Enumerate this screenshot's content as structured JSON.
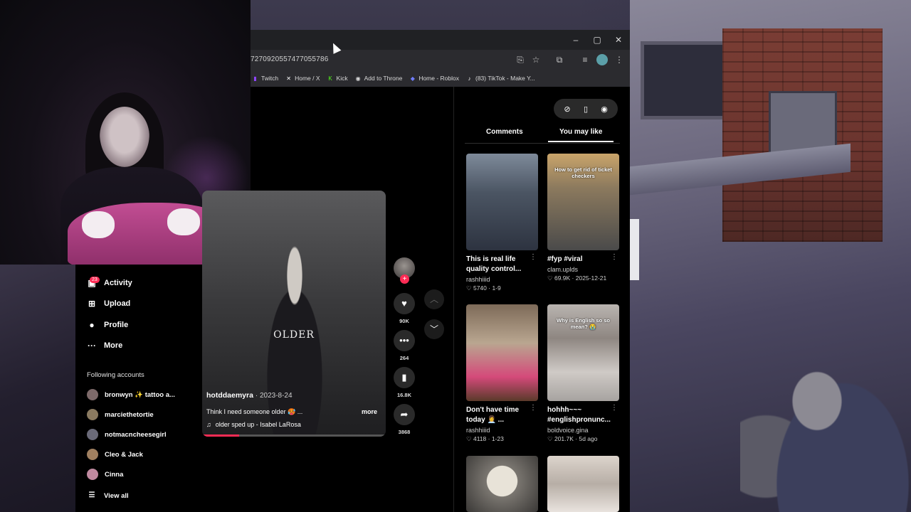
{
  "browser": {
    "url": "7270920557477055786",
    "bookmarks": [
      {
        "label": "Twitch",
        "icon": "twitch-icon",
        "color": "#9146ff",
        "glyph": "▮"
      },
      {
        "label": "Home / X",
        "icon": "x-icon",
        "color": "#ffffff",
        "glyph": "✕"
      },
      {
        "label": "Kick",
        "icon": "kick-icon",
        "color": "#53fc18",
        "glyph": "K"
      },
      {
        "label": "Add to Throne",
        "icon": "throne-icon",
        "color": "#dddddd",
        "glyph": "◉"
      },
      {
        "label": "Home - Roblox",
        "icon": "roblox-icon",
        "color": "#6f7dff",
        "glyph": "◆"
      },
      {
        "label": "(83) TikTok - Make Y...",
        "icon": "tiktok-icon",
        "color": "#ffffff",
        "glyph": "♪"
      }
    ]
  },
  "sidebar": {
    "items": [
      {
        "label": "Activity",
        "icon": "inbox-icon",
        "badge": "23"
      },
      {
        "label": "Upload",
        "icon": "upload-icon"
      },
      {
        "label": "Profile",
        "icon": "profile-icon"
      },
      {
        "label": "More",
        "icon": "more-icon"
      }
    ],
    "following_header": "Following accounts",
    "accounts": [
      {
        "name": "bronwyn ✨ tattoo a...",
        "color": "#7d6a6a"
      },
      {
        "name": "marciethetortie",
        "color": "#8a7a60"
      },
      {
        "name": "notmacncheesegirl",
        "color": "#6a6a78"
      },
      {
        "name": "Cleo & Jack",
        "color": "#a08060"
      },
      {
        "name": "Cinna",
        "color": "#c08aa0"
      }
    ],
    "view_all": "View all"
  },
  "video": {
    "overlay_text": "OLDER",
    "username": "hotddaemyra",
    "date": "· 2023-8-24",
    "caption": "Think I need someone older 🥵 ...",
    "more": "more",
    "music": "older sped up - Isabel LaRosa",
    "progress": 0.2
  },
  "actions": {
    "likes": "90K",
    "comments": "264",
    "saves": "16.8K",
    "shares": "3868"
  },
  "right_panel": {
    "tabs": [
      "Comments",
      "You may like"
    ],
    "active_tab": "You may like",
    "cards": [
      {
        "title": "This is real life quality control...",
        "author": "rashhiiid",
        "stats": "♡ 5740 · 1-9",
        "thumb_text": "",
        "thumb": "th1"
      },
      {
        "title": "#fyp #viral",
        "author": "clam.uplds",
        "stats": "♡ 69.9K · 2025-12-21",
        "thumb_text": "How to get rid of ticket checkers",
        "thumb": "th2"
      },
      {
        "title": "Don't have time today 👩‍💼 ...",
        "author": "rashhiiid",
        "stats": "♡ 4118 · 1-23",
        "thumb_text": "",
        "thumb": "th3"
      },
      {
        "title": "hohhh~~~ #englishpronunc...",
        "author": "boldvoice.gina",
        "stats": "♡ 201.7K · 5d ago",
        "thumb_text": "Why is English so so mean? 😭",
        "thumb": "th4"
      },
      {
        "title": "",
        "author": "",
        "stats": "",
        "thumb_text": "",
        "thumb": "th5"
      },
      {
        "title": "",
        "author": "",
        "stats": "",
        "thumb_text": "",
        "thumb": "th6"
      }
    ]
  }
}
